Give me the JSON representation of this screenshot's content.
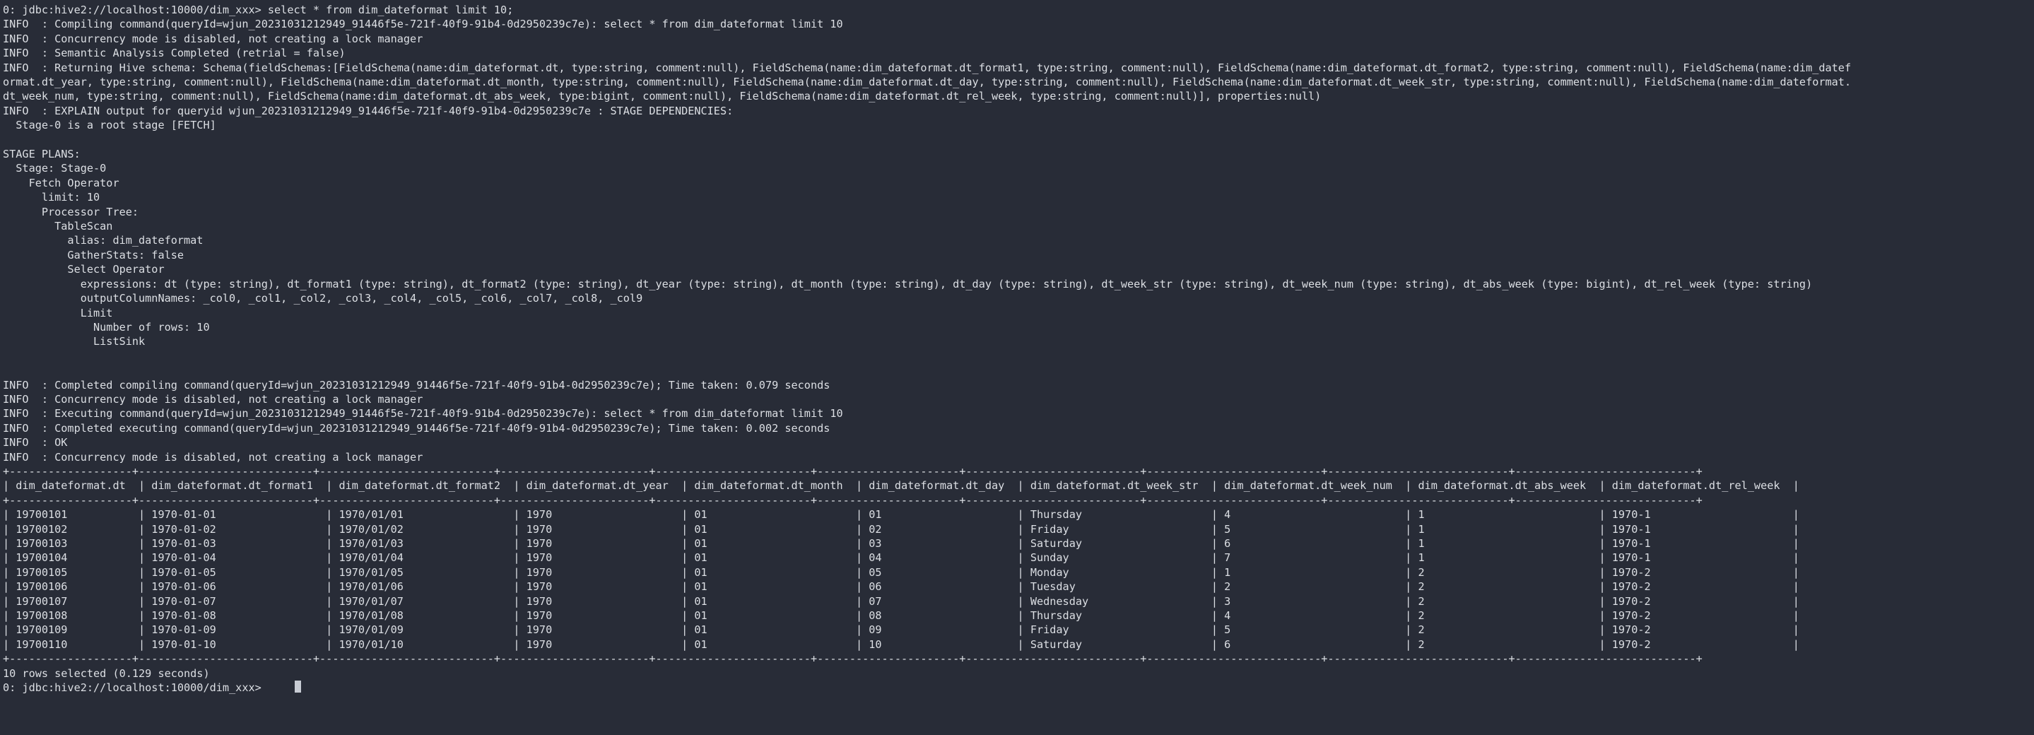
{
  "terminal": {
    "shell": "beeline",
    "colors": {
      "background": "#282c37",
      "foreground": "#dcdfe4",
      "cursor": "#c8ccd4"
    },
    "prompt": "0: jdbc:hive2://localhost:10000/dim_xxx>",
    "command": "select * from dim_dateformat limit 10;",
    "lines": [
      "0: jdbc:hive2://localhost:10000/dim_xxx> select * from dim_dateformat limit 10;",
      "INFO  : Compiling command(queryId=wjun_20231031212949_91446f5e-721f-40f9-91b4-0d2950239c7e): select * from dim_dateformat limit 10",
      "INFO  : Concurrency mode is disabled, not creating a lock manager",
      "INFO  : Semantic Analysis Completed (retrial = false)",
      "INFO  : Returning Hive schema: Schema(fieldSchemas:[FieldSchema(name:dim_dateformat.dt, type:string, comment:null), FieldSchema(name:dim_dateformat.dt_format1, type:string, comment:null), FieldSchema(name:dim_dateformat.dt_format2, type:string, comment:null), FieldSchema(name:dim_datef",
      "ormat.dt_year, type:string, comment:null), FieldSchema(name:dim_dateformat.dt_month, type:string, comment:null), FieldSchema(name:dim_dateformat.dt_day, type:string, comment:null), FieldSchema(name:dim_dateformat.dt_week_str, type:string, comment:null), FieldSchema(name:dim_dateformat.",
      "dt_week_num, type:string, comment:null), FieldSchema(name:dim_dateformat.dt_abs_week, type:bigint, comment:null), FieldSchema(name:dim_dateformat.dt_rel_week, type:string, comment:null)], properties:null)",
      "INFO  : EXPLAIN output for queryid wjun_20231031212949_91446f5e-721f-40f9-91b4-0d2950239c7e : STAGE DEPENDENCIES:",
      "  Stage-0 is a root stage [FETCH]",
      "",
      "STAGE PLANS:",
      "  Stage: Stage-0",
      "    Fetch Operator",
      "      limit: 10",
      "      Processor Tree:",
      "        TableScan",
      "          alias: dim_dateformat",
      "          GatherStats: false",
      "          Select Operator",
      "            expressions: dt (type: string), dt_format1 (type: string), dt_format2 (type: string), dt_year (type: string), dt_month (type: string), dt_day (type: string), dt_week_str (type: string), dt_week_num (type: string), dt_abs_week (type: bigint), dt_rel_week (type: string)",
      "            outputColumnNames: _col0, _col1, _col2, _col3, _col4, _col5, _col6, _col7, _col8, _col9",
      "            Limit",
      "              Number of rows: 10",
      "              ListSink",
      "",
      "",
      "INFO  : Completed compiling command(queryId=wjun_20231031212949_91446f5e-721f-40f9-91b4-0d2950239c7e); Time taken: 0.079 seconds",
      "INFO  : Concurrency mode is disabled, not creating a lock manager",
      "INFO  : Executing command(queryId=wjun_20231031212949_91446f5e-721f-40f9-91b4-0d2950239c7e): select * from dim_dateformat limit 10",
      "INFO  : Completed executing command(queryId=wjun_20231031212949_91446f5e-721f-40f9-91b4-0d2950239c7e); Time taken: 0.002 seconds",
      "INFO  : OK",
      "INFO  : Concurrency mode is disabled, not creating a lock manager",
      "+-------------------+---------------------------+---------------------------+-----------------------+------------------------+----------------------+---------------------------+---------------------------+----------------------------+----------------------------+",
      "| dim_dateformat.dt  | dim_dateformat.dt_format1  | dim_dateformat.dt_format2  | dim_dateformat.dt_year  | dim_dateformat.dt_month  | dim_dateformat.dt_day  | dim_dateformat.dt_week_str  | dim_dateformat.dt_week_num  | dim_dateformat.dt_abs_week  | dim_dateformat.dt_rel_week  |",
      "+-------------------+---------------------------+---------------------------+-----------------------+------------------------+----------------------+---------------------------+---------------------------+----------------------------+----------------------------+",
      "| 19700101           | 1970-01-01                 | 1970/01/01                 | 1970                    | 01                       | 01                     | Thursday                    | 4                           | 1                           | 1970-1                      |",
      "| 19700102           | 1970-01-02                 | 1970/01/02                 | 1970                    | 01                       | 02                     | Friday                      | 5                           | 1                           | 1970-1                      |",
      "| 19700103           | 1970-01-03                 | 1970/01/03                 | 1970                    | 01                       | 03                     | Saturday                    | 6                           | 1                           | 1970-1                      |",
      "| 19700104           | 1970-01-04                 | 1970/01/04                 | 1970                    | 01                       | 04                     | Sunday                      | 7                           | 1                           | 1970-1                      |",
      "| 19700105           | 1970-01-05                 | 1970/01/05                 | 1970                    | 01                       | 05                     | Monday                      | 1                           | 2                           | 1970-2                      |",
      "| 19700106           | 1970-01-06                 | 1970/01/06                 | 1970                    | 01                       | 06                     | Tuesday                     | 2                           | 2                           | 1970-2                      |",
      "| 19700107           | 1970-01-07                 | 1970/01/07                 | 1970                    | 01                       | 07                     | Wednesday                   | 3                           | 2                           | 1970-2                      |",
      "| 19700108           | 1970-01-08                 | 1970/01/08                 | 1970                    | 01                       | 08                     | Thursday                    | 4                           | 2                           | 1970-2                      |",
      "| 19700109           | 1970-01-09                 | 1970/01/09                 | 1970                    | 01                       | 09                     | Friday                      | 5                           | 2                           | 1970-2                      |",
      "| 19700110           | 1970-01-10                 | 1970/01/10                 | 1970                    | 01                       | 10                     | Saturday                    | 6                           | 2                           | 1970-2                      |",
      "+-------------------+---------------------------+---------------------------+-----------------------+------------------------+----------------------+---------------------------+---------------------------+----------------------------+----------------------------+",
      "10 rows selected (0.129 seconds)"
    ],
    "trailing_prompt": "0: jdbc:hive2://localhost:10000/dim_xxx>"
  },
  "result_table": {
    "columns": [
      "dim_dateformat.dt",
      "dim_dateformat.dt_format1",
      "dim_dateformat.dt_format2",
      "dim_dateformat.dt_year",
      "dim_dateformat.dt_month",
      "dim_dateformat.dt_day",
      "dim_dateformat.dt_week_str",
      "dim_dateformat.dt_week_num",
      "dim_dateformat.dt_abs_week",
      "dim_dateformat.dt_rel_week"
    ],
    "rows": [
      [
        "19700101",
        "1970-01-01",
        "1970/01/01",
        "1970",
        "01",
        "01",
        "Thursday",
        "4",
        "1",
        "1970-1"
      ],
      [
        "19700102",
        "1970-01-02",
        "1970/01/02",
        "1970",
        "01",
        "02",
        "Friday",
        "5",
        "1",
        "1970-1"
      ],
      [
        "19700103",
        "1970-01-03",
        "1970/01/03",
        "1970",
        "01",
        "03",
        "Saturday",
        "6",
        "1",
        "1970-1"
      ],
      [
        "19700104",
        "1970-01-04",
        "1970/01/04",
        "1970",
        "01",
        "04",
        "Sunday",
        "7",
        "1",
        "1970-1"
      ],
      [
        "19700105",
        "1970-01-05",
        "1970/01/05",
        "1970",
        "01",
        "05",
        "Monday",
        "1",
        "2",
        "1970-2"
      ],
      [
        "19700106",
        "1970-01-06",
        "1970/01/06",
        "1970",
        "01",
        "06",
        "Tuesday",
        "2",
        "2",
        "1970-2"
      ],
      [
        "19700107",
        "1970-01-07",
        "1970/01/07",
        "1970",
        "01",
        "07",
        "Wednesday",
        "3",
        "2",
        "1970-2"
      ],
      [
        "19700108",
        "1970-01-08",
        "1970/01/08",
        "1970",
        "01",
        "08",
        "Thursday",
        "4",
        "2",
        "1970-2"
      ],
      [
        "19700109",
        "1970-01-09",
        "1970/01/09",
        "1970",
        "01",
        "09",
        "Friday",
        "5",
        "2",
        "1970-2"
      ],
      [
        "19700110",
        "1970-01-10",
        "1970/01/10",
        "1970",
        "01",
        "10",
        "Saturday",
        "6",
        "2",
        "1970-2"
      ]
    ],
    "footer": "10 rows selected (0.129 seconds)",
    "row_count": 10,
    "elapsed_seconds": 0.129
  },
  "query_info": {
    "query_id": "wjun_20231031212949_91446f5e-721f-40f9-91b4-0d2950239c7e",
    "compile_time_seconds": 0.079,
    "execute_time_seconds": 0.002,
    "status": "OK",
    "stage": "Stage-0",
    "stage_type": "FETCH",
    "table_alias": "dim_dateformat",
    "limit": 10
  }
}
